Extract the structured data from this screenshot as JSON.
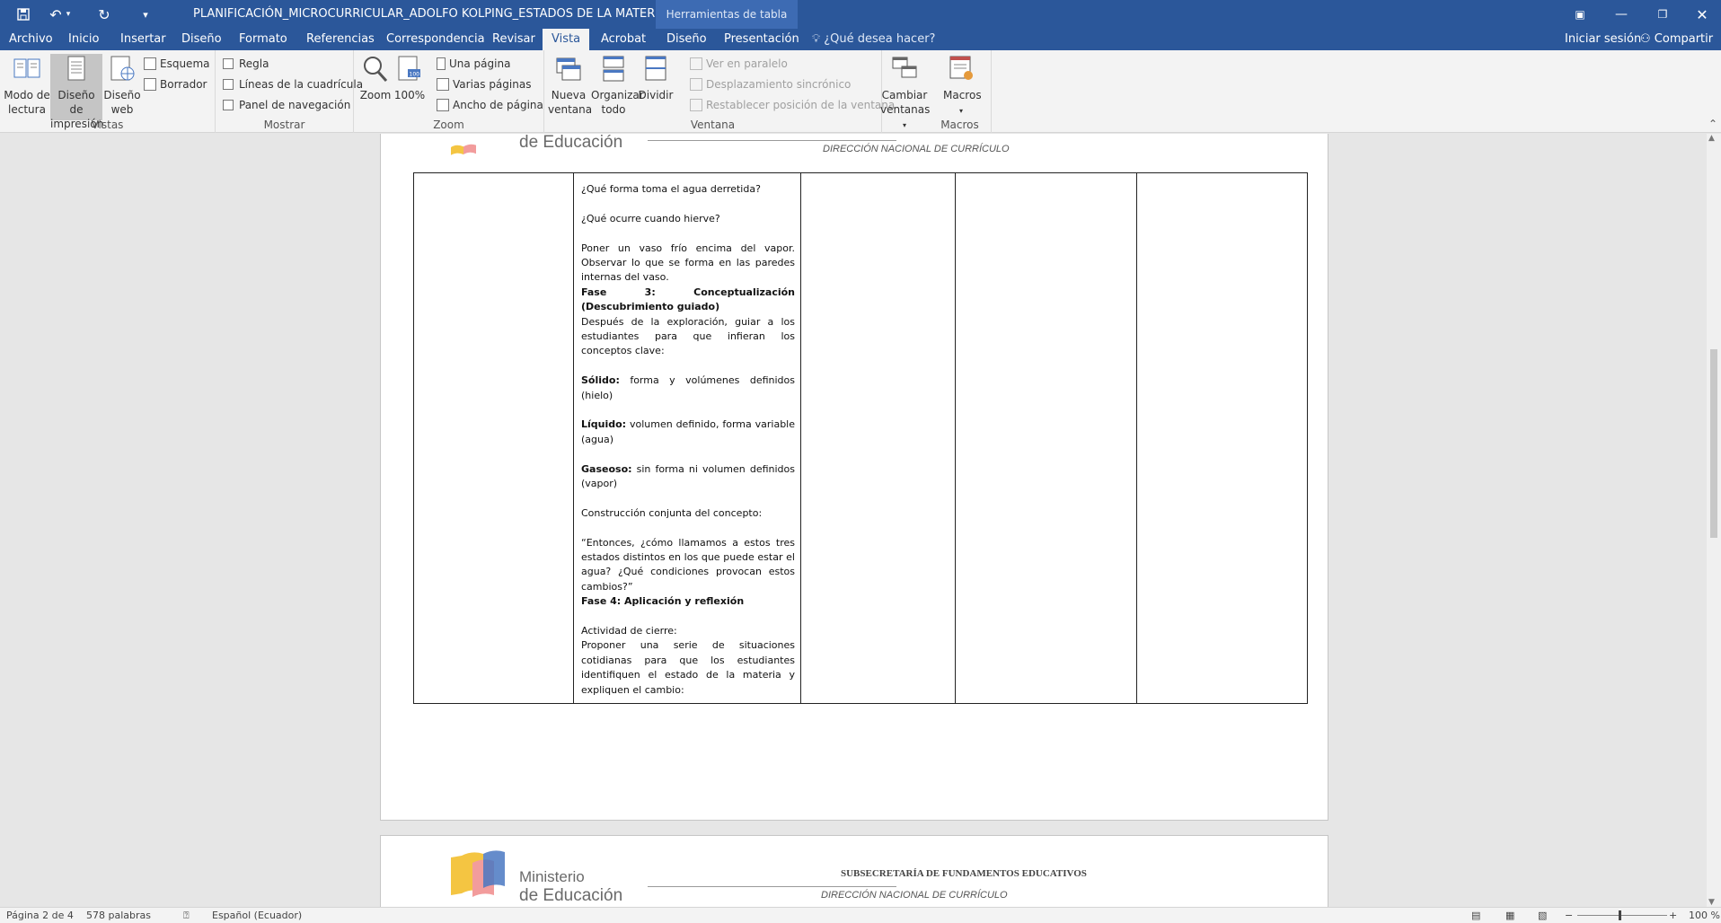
{
  "window": {
    "title": "PLANIFICACIÓN_MICROCURRICULAR_ADOLFO KOLPING_ESTADOS DE LA MATERIA - Word",
    "context_group": "Herramientas de tabla"
  },
  "tabs": [
    "Archivo",
    "Inicio",
    "Insertar",
    "Diseño",
    "Formato",
    "Referencias",
    "Correspondencia",
    "Revisar",
    "Vista",
    "Acrobat",
    "Diseño",
    "Presentación"
  ],
  "active_tab": "Vista",
  "tell_me": "¿Qué desea hacer?",
  "account": {
    "signin": "Iniciar sesión",
    "share": "Compartir"
  },
  "ribbon": {
    "vistas": {
      "label": "Vistas",
      "read_mode": "Modo de lectura",
      "print_layout": "Diseño de impresión",
      "web_layout": "Diseño web",
      "outline": "Esquema",
      "draft": "Borrador"
    },
    "mostrar": {
      "label": "Mostrar",
      "ruler": "Regla",
      "gridlines": "Líneas de la cuadrícula",
      "nav_pane": "Panel de navegación"
    },
    "zoom": {
      "label": "Zoom",
      "zoom": "Zoom",
      "hundred": "100%",
      "one_page": "Una página",
      "multi_page": "Varias páginas",
      "page_width": "Ancho de página"
    },
    "ventana": {
      "label": "Ventana",
      "new_window": "Nueva ventana",
      "arrange_all": "Organizar todo",
      "split": "Dividir",
      "side_by_side": "Ver en paralelo",
      "sync_scroll": "Desplazamiento sincrónico",
      "reset_pos": "Restablecer posición de la ventana",
      "switch_windows": "Cambiar ventanas"
    },
    "macros": {
      "label": "Macros",
      "macros": "Macros"
    }
  },
  "header": {
    "logo_line1": "Ministerio",
    "logo_line2": "de Educación",
    "subsecretaria": "SUBSECRETARÍA DE FUNDAMENTOS EDUCATIVOS",
    "direccion": "DIRECCIÓN NACIONAL  DE CURRÍCULO"
  },
  "cell": {
    "q1": "¿Qué forma toma el agua derretida?",
    "q2": "¿Qué ocurre cuando hierve?",
    "p1": "Poner un vaso frío encima del vapor. Observar lo que se forma en las paredes internas del vaso.",
    "fase3": "Fase 3: Conceptualización (Descubrimiento guiado)",
    "p2": "Después de la exploración, guiar a los estudiantes para que infieran los conceptos clave:",
    "solido_label": "Sólido:",
    "solido_text": " forma y volúmenes definidos (hielo)",
    "liquido_label": "Líquido:",
    "liquido_text": " volumen definido, forma variable (agua)",
    "gaseoso_label": "Gaseoso:",
    "gaseoso_text": " sin forma ni volumen definidos (vapor)",
    "p3": "Construcción conjunta del concepto:",
    "p4": "“Entonces, ¿cómo llamamos a estos tres estados distintos en los que puede estar el agua? ¿Qué condiciones provocan estos cambios?”",
    "fase4": "Fase 4: Aplicación y reflexión",
    "p5": "Actividad de cierre:",
    "p6": "Proponer una serie de situaciones cotidianas para que los estudiantes identifiquen el estado de la materia y expliquen el cambio:"
  },
  "status": {
    "page": "Página 2 de 4",
    "words": "578 palabras",
    "language": "Español (Ecuador)",
    "zoom": "100 %"
  },
  "colors": {
    "word_blue": "#2b579a",
    "ribbon_bg": "#f3f3f3"
  }
}
